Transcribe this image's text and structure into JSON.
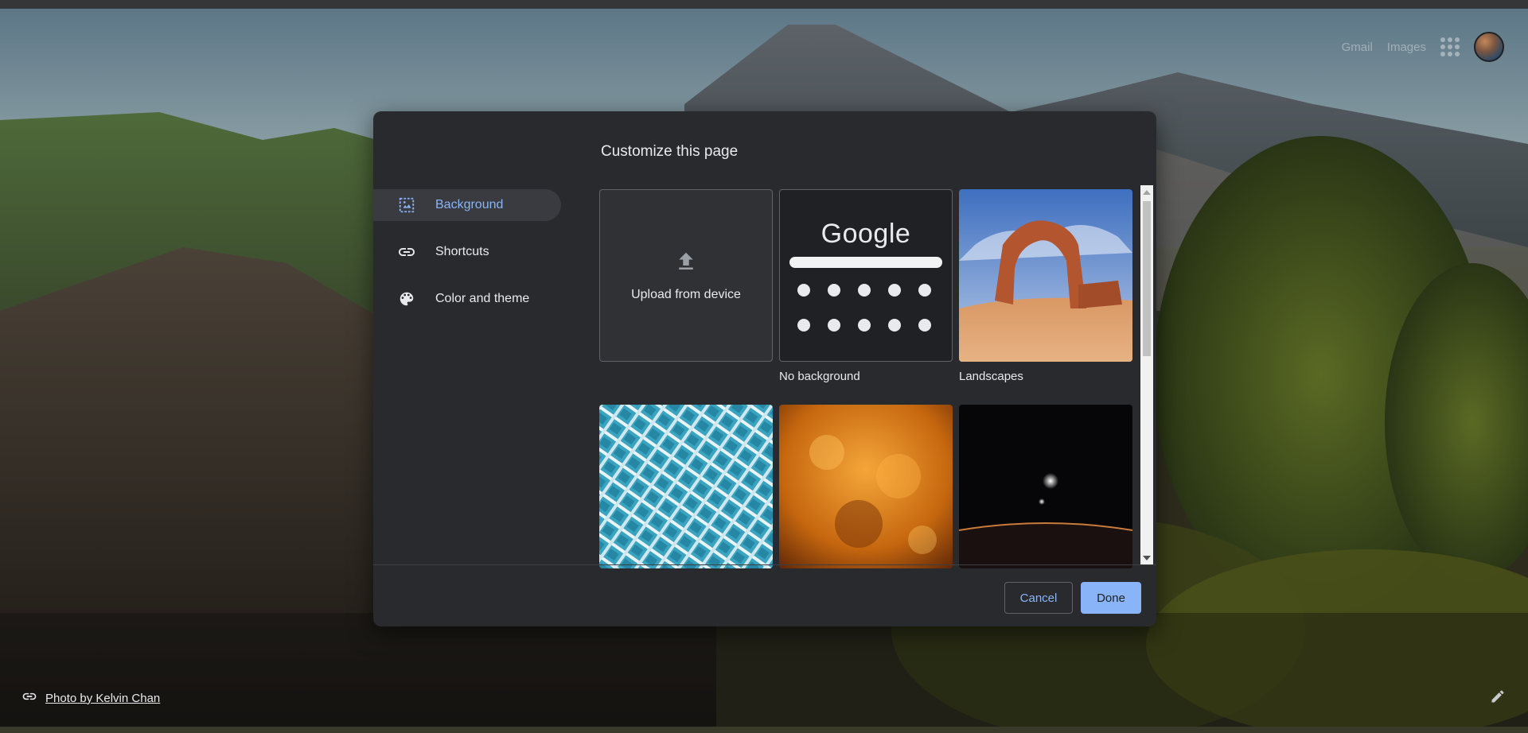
{
  "top_links": {
    "gmail": "Gmail",
    "images": "Images"
  },
  "attribution": {
    "text": "Photo by Kelvin Chan"
  },
  "dialog": {
    "title": "Customize this page",
    "sidebar": {
      "items": [
        {
          "label": "Background",
          "icon": "image-icon",
          "active": true
        },
        {
          "label": "Shortcuts",
          "icon": "link-icon",
          "active": false
        },
        {
          "label": "Color and theme",
          "icon": "palette-icon",
          "active": false
        }
      ]
    },
    "tiles": {
      "upload": {
        "label": "Upload from device"
      },
      "no_background": {
        "label": "No background",
        "logo_text": "Google"
      },
      "landscapes": {
        "label": "Landscapes"
      }
    },
    "buttons": {
      "cancel": "Cancel",
      "done": "Done"
    }
  },
  "colors": {
    "accent": "#8ab4f8",
    "dialog_bg": "#292a2d",
    "active_item_bg": "#393b40"
  }
}
